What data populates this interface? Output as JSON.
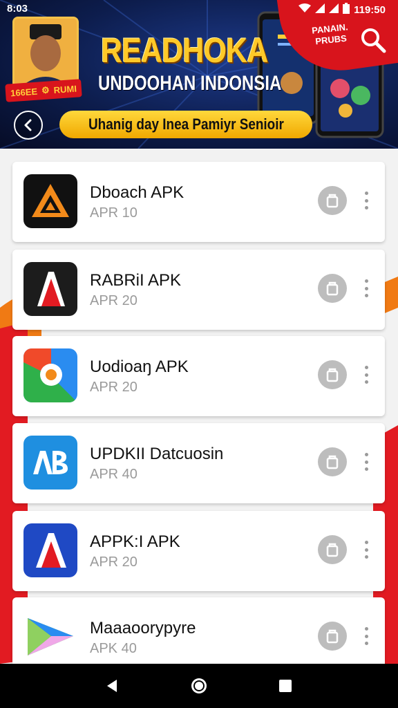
{
  "status_bar": {
    "time": "8:03",
    "right_text": "119:50"
  },
  "banner": {
    "title": "READHOKA",
    "subtitle": "UNDOOHAN INDONSIA",
    "pill_text": "Uhanig day Inea Pamiyr Senioir",
    "promo_text_line1": "PANAIN.",
    "promo_text_line2": "PRUBS",
    "badge_left": "166EE",
    "badge_right": "RUMI"
  },
  "apps": [
    {
      "name": "Dboach APK",
      "version": "APR 10",
      "icon": "orange-triangle-icon"
    },
    {
      "name": "RABRiI APK",
      "version": "APR 20",
      "icon": "red-a-logo-icon"
    },
    {
      "name": "Uodioaŋ APK",
      "version": "APR 20",
      "icon": "color-gear-icon"
    },
    {
      "name": "UPDKII Datcuosin",
      "version": "APR 40",
      "icon": "ab-blue-icon"
    },
    {
      "name": "APPK:I APK",
      "version": "APR 20",
      "icon": "blue-a-logo-icon"
    },
    {
      "name": "Maaaoorypyre",
      "version": "APK 40",
      "icon": "colorful-play-icon"
    }
  ],
  "icons": {
    "back": "chevron-left-icon",
    "search": "search-icon",
    "download": "download-icon",
    "more": "more-vert-icon",
    "nav_back": "nav-back-icon",
    "nav_home": "nav-home-icon",
    "nav_recent": "nav-recent-icon"
  },
  "colors": {
    "banner_bg": "#0d1d4d",
    "accent_red": "#d8141c",
    "title_yellow": "#ffc928",
    "pill_yellow": "#ffd83c"
  }
}
